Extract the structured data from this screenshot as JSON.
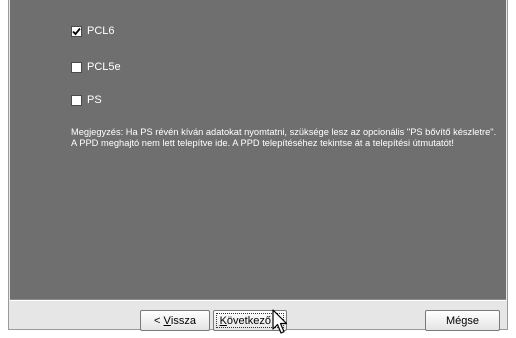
{
  "options": [
    {
      "label": "PCL6",
      "checked": true
    },
    {
      "label": "PCL5e",
      "checked": false
    },
    {
      "label": "PS",
      "checked": false
    }
  ],
  "note": "Megjegyzés: Ha PS révén kíván adatokat nyomtatni, szüksége lesz az opcionális \"PS bővítő készletre\". A PPD meghajtó nem lett telepítve ide. A PPD telepítéséhez tekintse át a telepítési útmutatót!",
  "buttons": {
    "back_prefix": "< ",
    "back_hotkey": "V",
    "back_rest": "issza",
    "next_hotkey": "K",
    "next_rest": "övetkező >",
    "cancel": "Mégse"
  },
  "icons": {
    "checkmark": "checkmark-icon",
    "cursor": "mouse-pointer-icon"
  }
}
